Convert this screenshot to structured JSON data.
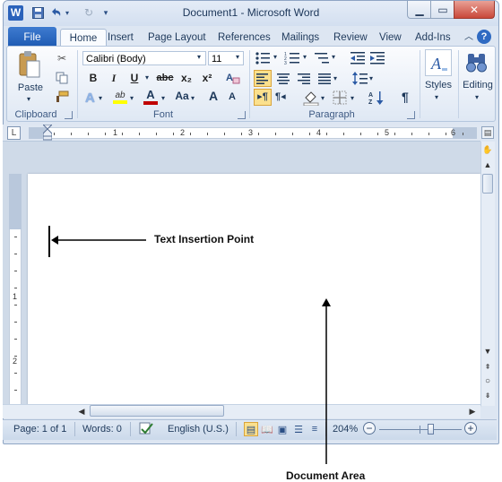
{
  "window": {
    "title": "Document1 - Microsoft Word",
    "app_icon": "W",
    "controls": {
      "minimize_icon": "minimize-icon",
      "maximize_icon": "maximize-icon",
      "close_icon": "close-icon"
    }
  },
  "quick_access": [
    "save-icon",
    "undo-icon",
    "redo-icon",
    "customize-icon"
  ],
  "tabs": {
    "file": "File",
    "home": "Home",
    "insert": "Insert",
    "page_layout": "Page Layout",
    "references": "References",
    "mailings": "Mailings",
    "review": "Review",
    "view": "View",
    "addins": "Add-Ins"
  },
  "ribbon": {
    "clipboard": {
      "label": "Clipboard",
      "paste": "Paste"
    },
    "font": {
      "label": "Font",
      "font_name": "Calibri (Body)",
      "font_size": "11",
      "bold": "B",
      "italic": "I",
      "underline": "U",
      "strike": "abc",
      "subscript": "x₂",
      "superscript": "x²",
      "grow": "A",
      "shrink": "A",
      "case": "Aa",
      "highlight": "ab"
    },
    "paragraph": {
      "label": "Paragraph"
    },
    "styles": {
      "label": "Styles"
    },
    "editing": {
      "label": "Editing"
    }
  },
  "ruler": {
    "numbers": [
      "1",
      "2",
      "3",
      "4",
      "5",
      "6"
    ],
    "tab_selector": "L"
  },
  "vruler": {
    "numbers": [
      "1",
      "2"
    ]
  },
  "status": {
    "page": "Page: 1 of 1",
    "words": "Words: 0",
    "language": "English (U.S.)",
    "zoom": "204%",
    "zoom_minus": "−",
    "zoom_plus": "+"
  },
  "annotations": {
    "insertion_point": "Text Insertion Point",
    "document_area": "Document Area"
  },
  "colors": {
    "file_tab": "#2a62bb",
    "highlight": "#fbe08d",
    "font_color": "#c00000",
    "close_button": "#c9483a"
  }
}
